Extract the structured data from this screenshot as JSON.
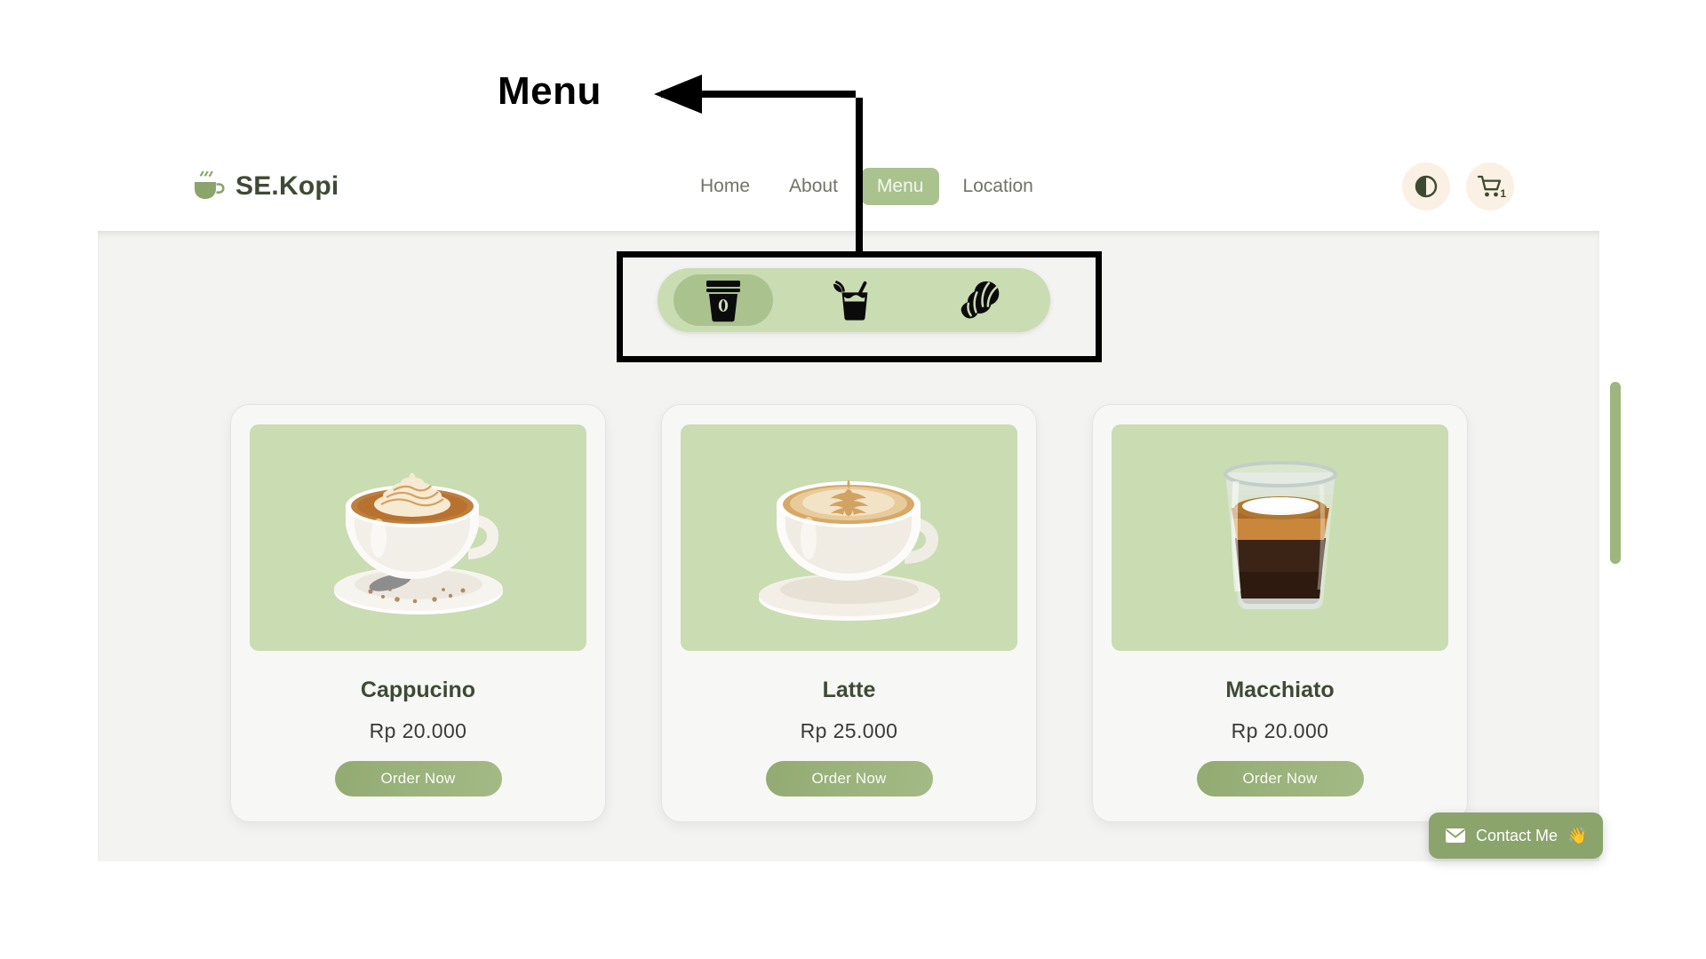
{
  "header": {
    "brand": {
      "icon": "coffee-cup-icon",
      "name": "SE.Kopi"
    },
    "nav": [
      {
        "label": "Home",
        "active": false
      },
      {
        "label": "About",
        "active": false
      },
      {
        "label": "Menu",
        "active": true
      },
      {
        "label": "Location",
        "active": false
      }
    ],
    "actions": {
      "theme_toggle_icon": "contrast-circle-icon",
      "cart_icon": "shopping-cart-icon",
      "cart_count": "1"
    }
  },
  "categories": [
    {
      "icon": "takeaway-coffee-cup-icon",
      "name": "coffee",
      "active": true
    },
    {
      "icon": "cold-drink-glass-icon",
      "name": "cold-drinks",
      "active": false
    },
    {
      "icon": "croissant-icon",
      "name": "pastries",
      "active": false
    }
  ],
  "products": [
    {
      "name": "Cappucino",
      "price": "Rp 20.000",
      "order_label": "Order Now",
      "image": "cappuccino-cup-photo"
    },
    {
      "name": "Latte",
      "price": "Rp 25.000",
      "order_label": "Order Now",
      "image": "latte-cup-photo"
    },
    {
      "name": "Macchiato",
      "price": "Rp 20.000",
      "order_label": "Order Now",
      "image": "macchiato-glass-photo"
    }
  ],
  "contact_fab": {
    "label": "Contact Me",
    "emoji": "👋",
    "icon": "envelope-icon"
  },
  "annotation": {
    "label": "Menu"
  },
  "colors": {
    "brand_green": "#a9c28e",
    "dark_green_text": "#3f4a35",
    "pill_background": "#cadcb2",
    "panel_background": "#f3f3f2",
    "card_background": "#f7f7f6",
    "button_cream": "#faf0e4",
    "contact_green": "#8aa46c",
    "scrollbar_green": "#9cb67e"
  }
}
